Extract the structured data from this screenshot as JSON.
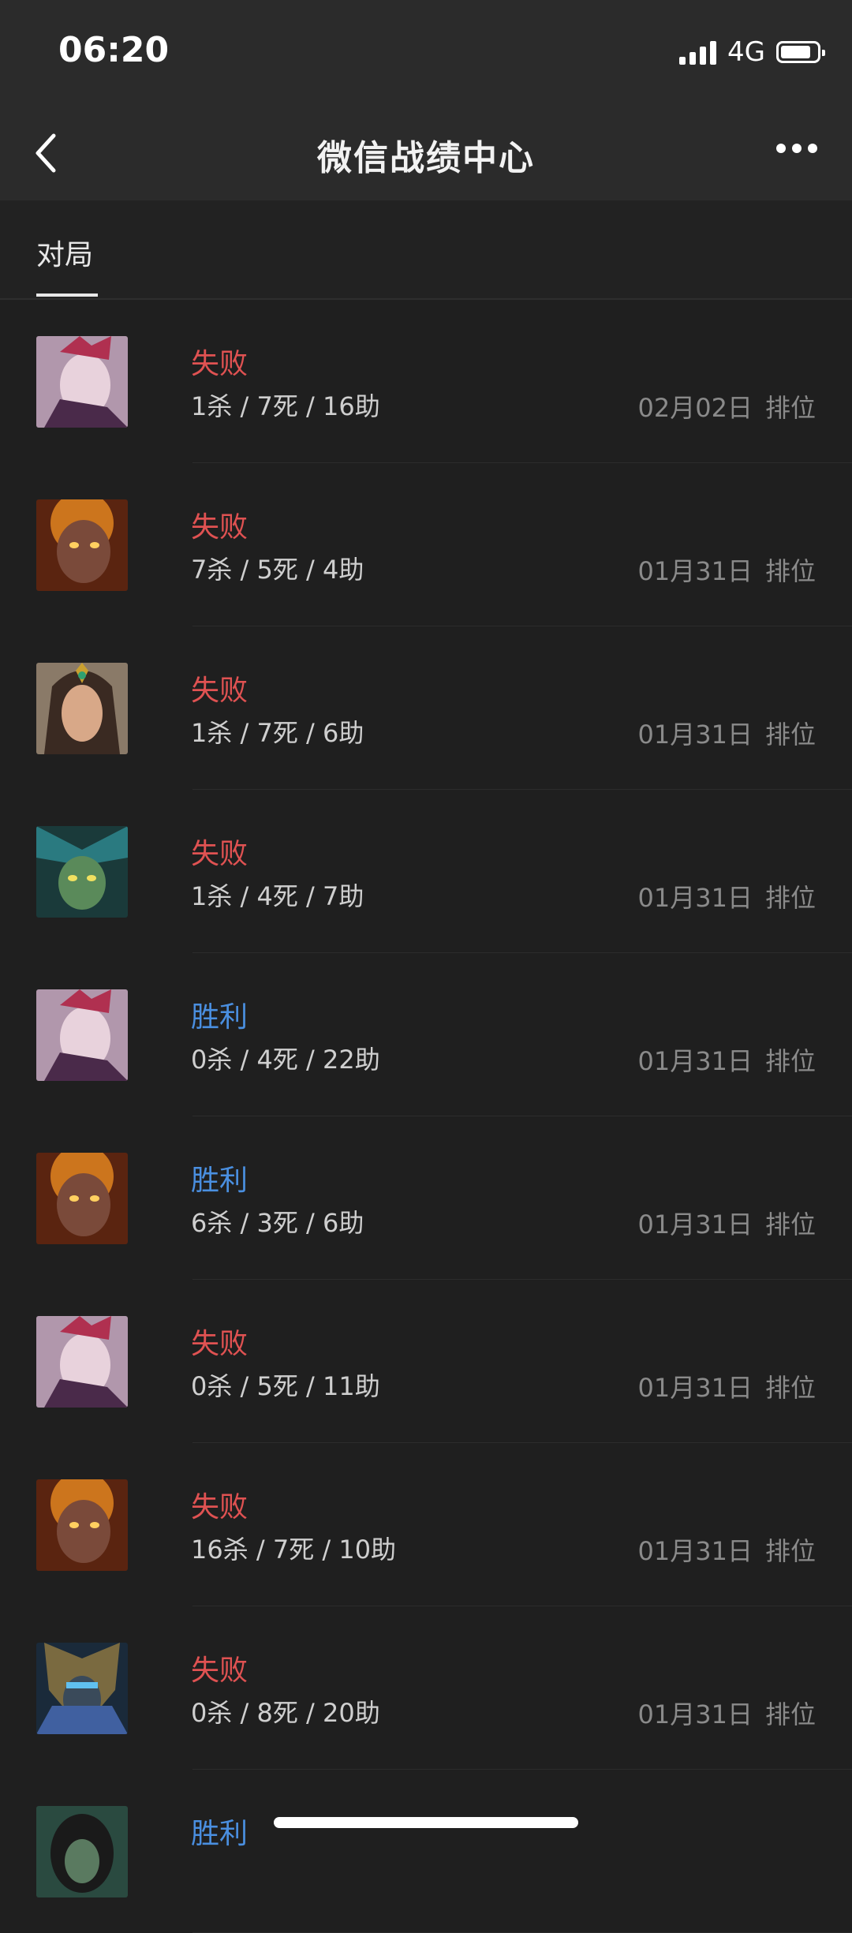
{
  "status_bar": {
    "time": "06:20",
    "network": "4G",
    "signal_icon": "cellular-signal-icon",
    "battery_icon": "battery-icon"
  },
  "nav": {
    "title": "微信战绩中心",
    "back_icon": "chevron-left-icon",
    "more_icon": "more-dots-icon"
  },
  "tabs": [
    {
      "label": "对局",
      "active": true
    }
  ],
  "colors": {
    "loss": "#e05252",
    "win": "#4a8fe0",
    "background": "#1f1f1f",
    "bar": "#2b2b2b"
  },
  "matches": [
    {
      "result": "失败",
      "outcome": "loss",
      "kda": "1杀 / 7死 / 16助",
      "date": "02月02日",
      "mode": "排位",
      "avatar": "hero-avatar-pale"
    },
    {
      "result": "失败",
      "outcome": "loss",
      "kda": "7杀 / 5死 / 4助",
      "date": "01月31日",
      "mode": "排位",
      "avatar": "hero-avatar-fire"
    },
    {
      "result": "失败",
      "outcome": "loss",
      "kda": "1杀 / 7死 / 6助",
      "date": "01月31日",
      "mode": "排位",
      "avatar": "hero-avatar-queen"
    },
    {
      "result": "失败",
      "outcome": "loss",
      "kda": "1杀 / 4死 / 7助",
      "date": "01月31日",
      "mode": "排位",
      "avatar": "hero-avatar-green"
    },
    {
      "result": "胜利",
      "outcome": "win",
      "kda": "0杀 / 4死 / 22助",
      "date": "01月31日",
      "mode": "排位",
      "avatar": "hero-avatar-pale"
    },
    {
      "result": "胜利",
      "outcome": "win",
      "kda": "6杀 / 3死 / 6助",
      "date": "01月31日",
      "mode": "排位",
      "avatar": "hero-avatar-fire"
    },
    {
      "result": "失败",
      "outcome": "loss",
      "kda": "0杀 / 5死 / 11助",
      "date": "01月31日",
      "mode": "排位",
      "avatar": "hero-avatar-pale"
    },
    {
      "result": "失败",
      "outcome": "loss",
      "kda": "16杀 / 7死 / 10助",
      "date": "01月31日",
      "mode": "排位",
      "avatar": "hero-avatar-fire"
    },
    {
      "result": "失败",
      "outcome": "loss",
      "kda": "0杀 / 8死 / 20助",
      "date": "01月31日",
      "mode": "排位",
      "avatar": "hero-avatar-armor"
    },
    {
      "result": "胜利",
      "outcome": "win",
      "kda": "",
      "date": "",
      "mode": "",
      "avatar": "hero-avatar-dark"
    }
  ]
}
